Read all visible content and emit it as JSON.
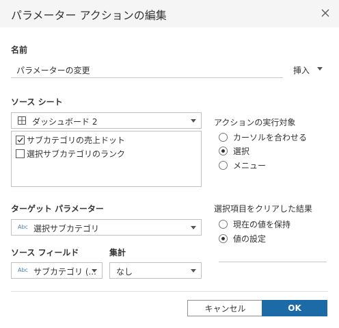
{
  "dialog": {
    "title": "パラメーター アクションの編集"
  },
  "name_section": {
    "label": "名前",
    "value": "パラメーターの変更",
    "insert_label": "挿入"
  },
  "source_sheet": {
    "label": "ソース シート",
    "selected": "ダッシュボード 2",
    "items": [
      {
        "label": "サブカテゴリの売上ドット",
        "checked": true
      },
      {
        "label": "選択サブカテゴリのランク",
        "checked": false
      }
    ]
  },
  "run_action_on": {
    "label": "アクションの実行対象",
    "options": [
      "カーソルを合わせる",
      "選択",
      "メニュー"
    ],
    "selected_index": 1
  },
  "target_parameter": {
    "label": "ターゲット パラメーター",
    "type_badge": "Abc",
    "selected": "選択サブカテゴリ"
  },
  "source_field": {
    "label": "ソース フィールド",
    "type_badge": "Abc",
    "selected": "サブカテゴリ (..."
  },
  "aggregation": {
    "label": "集計",
    "selected": "なし"
  },
  "clearing_result": {
    "label": "選択項目をクリアした結果",
    "options": [
      "現在の値を保持",
      "値の設定"
    ],
    "selected_index": 1
  },
  "buttons": {
    "cancel": "キャンセル",
    "ok": "OK"
  },
  "colors": {
    "primary": "#1d6ba6",
    "header_bg": "#f5f5f5"
  }
}
